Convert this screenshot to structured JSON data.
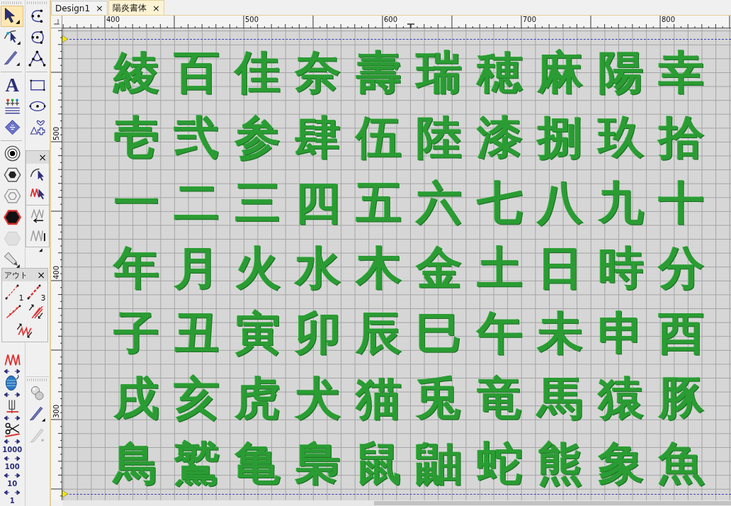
{
  "tabs": [
    {
      "label": "Design1",
      "close": "×",
      "selected": false
    },
    {
      "label": "陽炎書体",
      "close": "×",
      "selected": true
    }
  ],
  "toolbox": {
    "column_1": [
      {
        "kind": "arrow",
        "selected": true
      },
      {
        "kind": "node-arrow",
        "selected": false
      },
      {
        "kind": "knife",
        "selected": false
      },
      {
        "kind": "sep"
      },
      {
        "kind": "letter",
        "label": "A",
        "selected": false
      },
      {
        "kind": "people-lines",
        "selected": false
      },
      {
        "kind": "diamond",
        "selected": false
      },
      {
        "kind": "sep"
      },
      {
        "kind": "target",
        "selected": false
      },
      {
        "kind": "hex-nut",
        "selected": false
      },
      {
        "kind": "hex-spiral",
        "selected": false
      },
      {
        "kind": "filled-hexagon",
        "selected": false
      },
      {
        "kind": "faded-hexagon",
        "selected": false
      },
      {
        "kind": "pen",
        "selected": false
      }
    ],
    "column_2": [
      {
        "kind": "open-curve",
        "selected": false
      },
      {
        "kind": "closed-curve",
        "selected": false
      },
      {
        "kind": "peak-curve",
        "selected": false
      },
      {
        "kind": "sep"
      },
      {
        "kind": "rectangle",
        "selected": false
      },
      {
        "kind": "ellipse",
        "selected": false
      },
      {
        "kind": "shapes",
        "selected": false
      }
    ],
    "lower_column_1": [
      {
        "kind": "zigzag",
        "selected": false
      },
      {
        "kind": "arrows"
      },
      {
        "kind": "spool",
        "selected": false
      },
      {
        "kind": "arrows"
      },
      {
        "kind": "fork",
        "selected": false
      },
      {
        "kind": "arrows"
      },
      {
        "kind": "scissors",
        "selected": false
      },
      {
        "kind": "arrows"
      },
      {
        "kind": "number",
        "label": "1000",
        "selected": false
      },
      {
        "kind": "arrows"
      },
      {
        "kind": "number",
        "label": "100",
        "selected": false
      },
      {
        "kind": "arrows"
      },
      {
        "kind": "number",
        "label": "10",
        "selected": false
      },
      {
        "kind": "arrows"
      },
      {
        "kind": "number",
        "label": "1",
        "selected": false
      }
    ],
    "lower_column_2": [
      {
        "kind": "spheres",
        "selected": false
      },
      {
        "kind": "knife",
        "selected": false
      },
      {
        "kind": "faded-knife",
        "selected": false
      }
    ]
  },
  "stitch_panel": {
    "close": "×",
    "tools": [
      {
        "kind": "curve-pointer",
        "selected": false
      },
      {
        "kind": "zigzag-pointer",
        "selected": false
      },
      {
        "kind": "sep"
      },
      {
        "kind": "zigzag-return",
        "selected": false
      },
      {
        "kind": "zigzag-bar",
        "selected": false
      }
    ]
  },
  "outline_panel": {
    "title": "アウト",
    "close": "×",
    "tools": [
      {
        "kind": "dash-line",
        "label": "1",
        "selected": false
      },
      {
        "kind": "bold-dash-line",
        "label": "3",
        "selected": false
      },
      {
        "kind": "triangle-line",
        "selected": false
      },
      {
        "kind": "double-zigzag",
        "selected": false
      },
      {
        "kind": "zigzag-arrows",
        "selected": false
      }
    ]
  },
  "rulers": {
    "horizontal": [
      "400",
      "500",
      "600",
      "700",
      "800"
    ],
    "vertical": [
      "500",
      "400",
      "300"
    ]
  },
  "design": {
    "rows": [
      [
        "綾",
        "百",
        "佳",
        "奈",
        "壽",
        "瑞",
        "穂",
        "麻",
        "陽",
        "幸"
      ],
      [
        "壱",
        "弐",
        "参",
        "肆",
        "伍",
        "陸",
        "漆",
        "捌",
        "玖",
        "拾"
      ],
      [
        "一",
        "二",
        "三",
        "四",
        "五",
        "六",
        "七",
        "八",
        "九",
        "十"
      ],
      [
        "年",
        "月",
        "火",
        "水",
        "木",
        "金",
        "土",
        "日",
        "時",
        "分"
      ],
      [
        "子",
        "丑",
        "寅",
        "卯",
        "辰",
        "巳",
        "午",
        "未",
        "申",
        "酉"
      ],
      [
        "戌",
        "亥",
        "虎",
        "犬",
        "猫",
        "兎",
        "竜",
        "馬",
        "猿",
        "豚"
      ],
      [
        "鳥",
        "鷲",
        "亀",
        "梟",
        "鼠",
        "鼬",
        "蛇",
        "熊",
        "象",
        "魚"
      ]
    ]
  }
}
